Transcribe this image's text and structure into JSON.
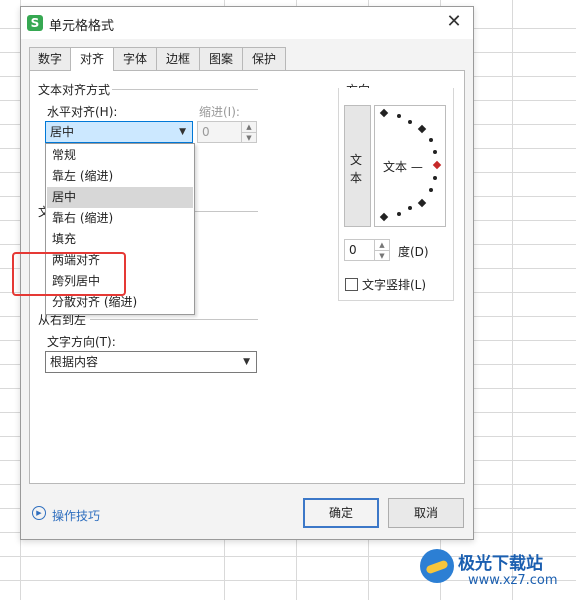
{
  "dialog": {
    "app_icon": "S",
    "title": "单元格格式",
    "close_glyph": "✕"
  },
  "tabs": [
    "数字",
    "对齐",
    "字体",
    "边框",
    "图案",
    "保护"
  ],
  "alignment": {
    "section_title": "文本对齐方式",
    "horizontal_label": "水平对齐(H):",
    "horizontal_value": "居中",
    "indent_label": "缩进(I):",
    "indent_value": "0",
    "hidden_label_fragment": "文",
    "rtl_section_title": "从右到左",
    "text_direction_label": "文字方向(T):",
    "text_direction_value": "根据内容"
  },
  "horizontal_options": [
    "常规",
    "靠左 (缩进)",
    "居中",
    "靠右 (缩进)",
    "填充",
    "两端对齐",
    "跨列居中",
    "分散对齐 (缩进)"
  ],
  "horizontal_selected_index": 2,
  "orientation": {
    "title": "方向",
    "vertical_text": [
      "文",
      "本"
    ],
    "dial_text": "文本 —",
    "degree_value": "0",
    "degree_label": "度(D)",
    "vertical_text_checkbox_label": "文字竖排(L)",
    "vertical_text_checked": false
  },
  "footer": {
    "help_label": "操作技巧",
    "ok_label": "确定",
    "cancel_label": "取消"
  },
  "watermark": {
    "name": "极光下载站",
    "url": "www.xz7.com"
  },
  "colors": {
    "accent": "#0078d7",
    "highlight_box": "#e53935",
    "help_link": "#2f6fbf"
  }
}
